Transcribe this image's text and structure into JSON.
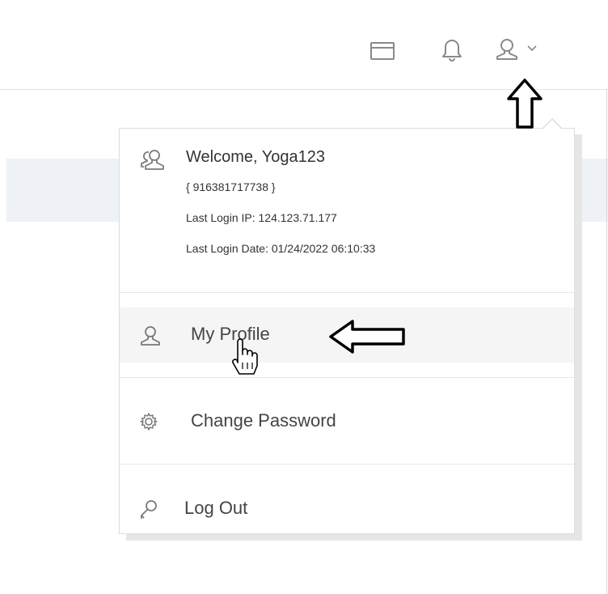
{
  "header": {
    "icons": [
      "card-icon",
      "bell-icon",
      "user-icon",
      "chevron-down-icon"
    ]
  },
  "user_menu": {
    "welcome": "Welcome, Yoga123",
    "account_id": "{ 916381717738 }",
    "last_login_ip": "Last Login IP: 124.123.71.177",
    "last_login_date": "Last Login Date: 01/24/2022 06:10:33",
    "items": [
      {
        "label": "My Profile",
        "icon": "user-icon"
      },
      {
        "label": "Change Password",
        "icon": "gear-icon"
      },
      {
        "label": "Log Out",
        "icon": "key-icon"
      }
    ]
  },
  "annotations": [
    "arrow-up-icon",
    "arrow-left-icon",
    "hand-cursor-icon"
  ]
}
